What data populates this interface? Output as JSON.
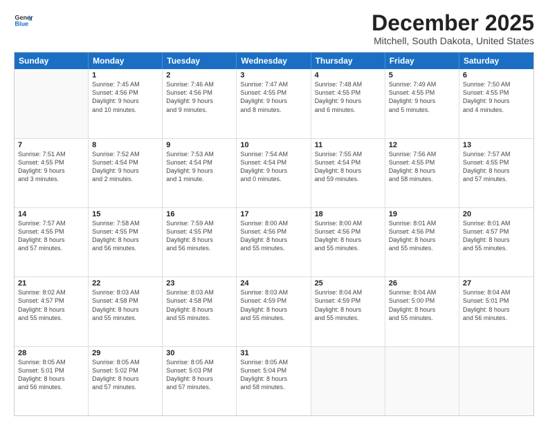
{
  "header": {
    "logo_line1": "General",
    "logo_line2": "Blue",
    "month_title": "December 2025",
    "location": "Mitchell, South Dakota, United States"
  },
  "days_of_week": [
    "Sunday",
    "Monday",
    "Tuesday",
    "Wednesday",
    "Thursday",
    "Friday",
    "Saturday"
  ],
  "weeks": [
    [
      {
        "day": "",
        "lines": []
      },
      {
        "day": "1",
        "lines": [
          "Sunrise: 7:45 AM",
          "Sunset: 4:56 PM",
          "Daylight: 9 hours",
          "and 10 minutes."
        ]
      },
      {
        "day": "2",
        "lines": [
          "Sunrise: 7:46 AM",
          "Sunset: 4:56 PM",
          "Daylight: 9 hours",
          "and 9 minutes."
        ]
      },
      {
        "day": "3",
        "lines": [
          "Sunrise: 7:47 AM",
          "Sunset: 4:55 PM",
          "Daylight: 9 hours",
          "and 8 minutes."
        ]
      },
      {
        "day": "4",
        "lines": [
          "Sunrise: 7:48 AM",
          "Sunset: 4:55 PM",
          "Daylight: 9 hours",
          "and 6 minutes."
        ]
      },
      {
        "day": "5",
        "lines": [
          "Sunrise: 7:49 AM",
          "Sunset: 4:55 PM",
          "Daylight: 9 hours",
          "and 5 minutes."
        ]
      },
      {
        "day": "6",
        "lines": [
          "Sunrise: 7:50 AM",
          "Sunset: 4:55 PM",
          "Daylight: 9 hours",
          "and 4 minutes."
        ]
      }
    ],
    [
      {
        "day": "7",
        "lines": [
          "Sunrise: 7:51 AM",
          "Sunset: 4:55 PM",
          "Daylight: 9 hours",
          "and 3 minutes."
        ]
      },
      {
        "day": "8",
        "lines": [
          "Sunrise: 7:52 AM",
          "Sunset: 4:54 PM",
          "Daylight: 9 hours",
          "and 2 minutes."
        ]
      },
      {
        "day": "9",
        "lines": [
          "Sunrise: 7:53 AM",
          "Sunset: 4:54 PM",
          "Daylight: 9 hours",
          "and 1 minute."
        ]
      },
      {
        "day": "10",
        "lines": [
          "Sunrise: 7:54 AM",
          "Sunset: 4:54 PM",
          "Daylight: 9 hours",
          "and 0 minutes."
        ]
      },
      {
        "day": "11",
        "lines": [
          "Sunrise: 7:55 AM",
          "Sunset: 4:54 PM",
          "Daylight: 8 hours",
          "and 59 minutes."
        ]
      },
      {
        "day": "12",
        "lines": [
          "Sunrise: 7:56 AM",
          "Sunset: 4:55 PM",
          "Daylight: 8 hours",
          "and 58 minutes."
        ]
      },
      {
        "day": "13",
        "lines": [
          "Sunrise: 7:57 AM",
          "Sunset: 4:55 PM",
          "Daylight: 8 hours",
          "and 57 minutes."
        ]
      }
    ],
    [
      {
        "day": "14",
        "lines": [
          "Sunrise: 7:57 AM",
          "Sunset: 4:55 PM",
          "Daylight: 8 hours",
          "and 57 minutes."
        ]
      },
      {
        "day": "15",
        "lines": [
          "Sunrise: 7:58 AM",
          "Sunset: 4:55 PM",
          "Daylight: 8 hours",
          "and 56 minutes."
        ]
      },
      {
        "day": "16",
        "lines": [
          "Sunrise: 7:59 AM",
          "Sunset: 4:55 PM",
          "Daylight: 8 hours",
          "and 56 minutes."
        ]
      },
      {
        "day": "17",
        "lines": [
          "Sunrise: 8:00 AM",
          "Sunset: 4:56 PM",
          "Daylight: 8 hours",
          "and 55 minutes."
        ]
      },
      {
        "day": "18",
        "lines": [
          "Sunrise: 8:00 AM",
          "Sunset: 4:56 PM",
          "Daylight: 8 hours",
          "and 55 minutes."
        ]
      },
      {
        "day": "19",
        "lines": [
          "Sunrise: 8:01 AM",
          "Sunset: 4:56 PM",
          "Daylight: 8 hours",
          "and 55 minutes."
        ]
      },
      {
        "day": "20",
        "lines": [
          "Sunrise: 8:01 AM",
          "Sunset: 4:57 PM",
          "Daylight: 8 hours",
          "and 55 minutes."
        ]
      }
    ],
    [
      {
        "day": "21",
        "lines": [
          "Sunrise: 8:02 AM",
          "Sunset: 4:57 PM",
          "Daylight: 8 hours",
          "and 55 minutes."
        ]
      },
      {
        "day": "22",
        "lines": [
          "Sunrise: 8:03 AM",
          "Sunset: 4:58 PM",
          "Daylight: 8 hours",
          "and 55 minutes."
        ]
      },
      {
        "day": "23",
        "lines": [
          "Sunrise: 8:03 AM",
          "Sunset: 4:58 PM",
          "Daylight: 8 hours",
          "and 55 minutes."
        ]
      },
      {
        "day": "24",
        "lines": [
          "Sunrise: 8:03 AM",
          "Sunset: 4:59 PM",
          "Daylight: 8 hours",
          "and 55 minutes."
        ]
      },
      {
        "day": "25",
        "lines": [
          "Sunrise: 8:04 AM",
          "Sunset: 4:59 PM",
          "Daylight: 8 hours",
          "and 55 minutes."
        ]
      },
      {
        "day": "26",
        "lines": [
          "Sunrise: 8:04 AM",
          "Sunset: 5:00 PM",
          "Daylight: 8 hours",
          "and 55 minutes."
        ]
      },
      {
        "day": "27",
        "lines": [
          "Sunrise: 8:04 AM",
          "Sunset: 5:01 PM",
          "Daylight: 8 hours",
          "and 56 minutes."
        ]
      }
    ],
    [
      {
        "day": "28",
        "lines": [
          "Sunrise: 8:05 AM",
          "Sunset: 5:01 PM",
          "Daylight: 8 hours",
          "and 56 minutes."
        ]
      },
      {
        "day": "29",
        "lines": [
          "Sunrise: 8:05 AM",
          "Sunset: 5:02 PM",
          "Daylight: 8 hours",
          "and 57 minutes."
        ]
      },
      {
        "day": "30",
        "lines": [
          "Sunrise: 8:05 AM",
          "Sunset: 5:03 PM",
          "Daylight: 8 hours",
          "and 57 minutes."
        ]
      },
      {
        "day": "31",
        "lines": [
          "Sunrise: 8:05 AM",
          "Sunset: 5:04 PM",
          "Daylight: 8 hours",
          "and 58 minutes."
        ]
      },
      {
        "day": "",
        "lines": []
      },
      {
        "day": "",
        "lines": []
      },
      {
        "day": "",
        "lines": []
      }
    ]
  ]
}
